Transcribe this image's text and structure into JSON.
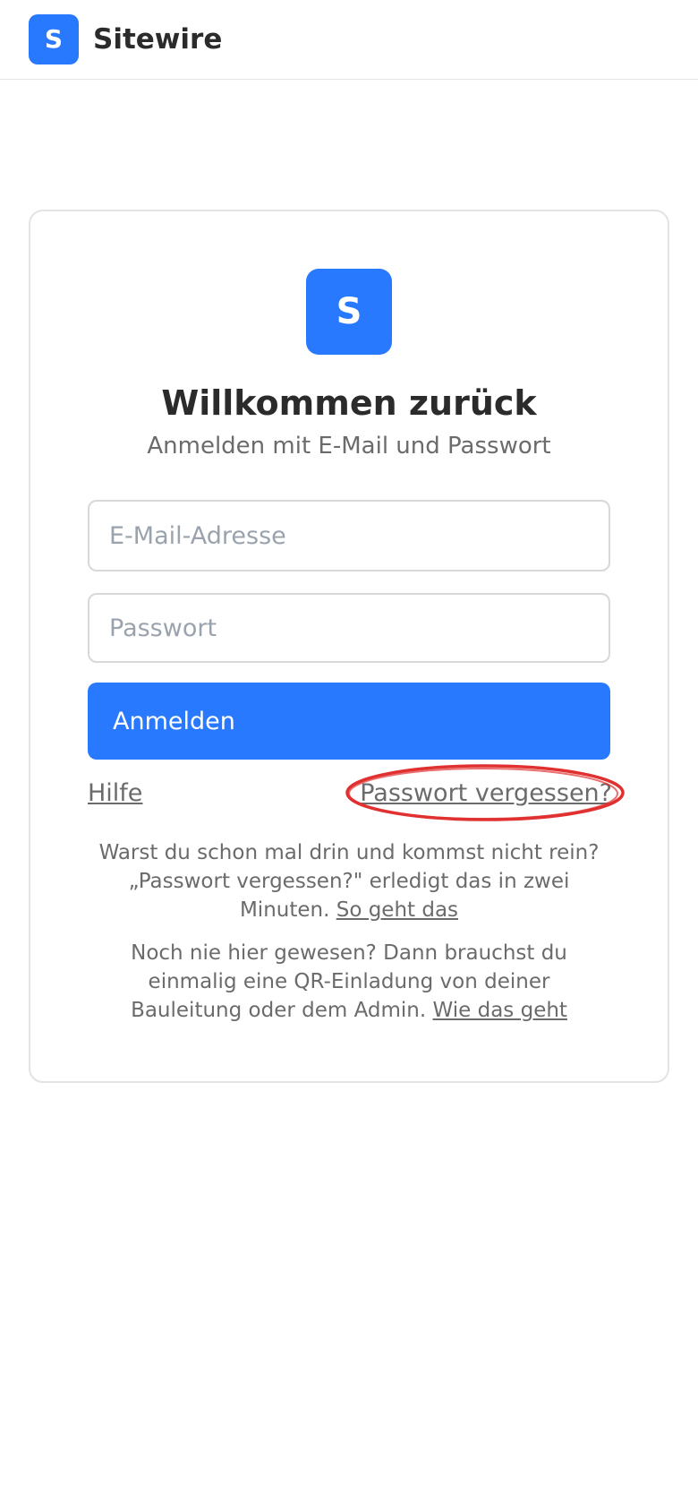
{
  "header": {
    "logo_letter": "S",
    "app_name": "Sitewire"
  },
  "card": {
    "logo_letter": "S",
    "title": "Willkommen zurück",
    "subtitle": "Anmelden mit E-Mail und Passwort",
    "email": {
      "placeholder": "E-Mail-Adresse",
      "value": ""
    },
    "password": {
      "placeholder": "Passwort",
      "value": ""
    },
    "submit_label": "Anmelden",
    "help_link": "Hilfe",
    "forgot_link": "Passwort vergessen?",
    "info_returning": {
      "text": "Warst du schon mal drin und kommst nicht rein? „Passwort vergessen?\" erledigt das in zwei Minuten.",
      "link": "So geht das"
    },
    "info_new": {
      "text": "Noch nie hier gewesen? Dann brauchst du einmalig eine QR-Einladung von deiner Bauleitung oder dem Admin.",
      "link": "Wie das geht"
    }
  },
  "colors": {
    "accent": "#2979ff",
    "annotation": "#e03030",
    "muted_text": "#6b6b6b"
  }
}
